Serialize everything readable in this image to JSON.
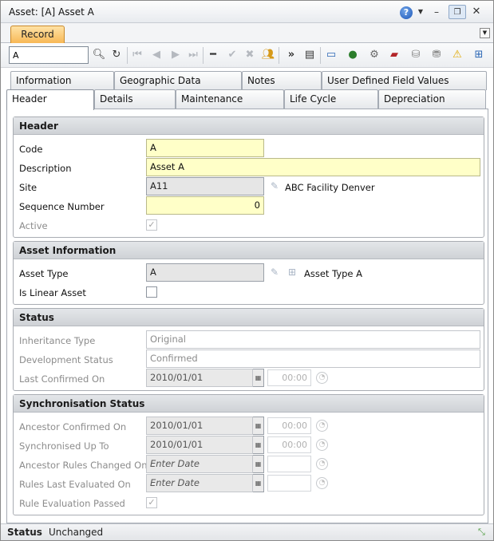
{
  "window": {
    "title": "Asset: [A] Asset A"
  },
  "ribbon": {
    "record_tab": "Record"
  },
  "toolbar": {
    "search_value": "A"
  },
  "tabs_row1": [
    "Information",
    "Geographic Data",
    "Notes",
    "User Defined Field Values"
  ],
  "tabs_row2": [
    "Header",
    "Details",
    "Maintenance",
    "Life Cycle",
    "Depreciation"
  ],
  "header_section": {
    "title": "Header",
    "code_label": "Code",
    "code_value": "A",
    "description_label": "Description",
    "description_value": "Asset A",
    "site_label": "Site",
    "site_value": "A11",
    "site_description": "ABC Facility Denver",
    "sequence_label": "Sequence Number",
    "sequence_value": "0",
    "active_label": "Active"
  },
  "asset_info_section": {
    "title": "Asset Information",
    "asset_type_label": "Asset Type",
    "asset_type_value": "A",
    "asset_type_description": "Asset Type A",
    "is_linear_label": "Is Linear Asset"
  },
  "status_section": {
    "title": "Status",
    "inheritance_label": "Inheritance Type",
    "inheritance_value": "Original",
    "development_label": "Development Status",
    "development_value": "Confirmed",
    "last_confirmed_label": "Last Confirmed On",
    "last_confirmed_date": "2010/01/01",
    "last_confirmed_time": "00:00"
  },
  "sync_section": {
    "title": "Synchronisation Status",
    "ancestor_confirmed_label": "Ancestor Confirmed On",
    "ancestor_confirmed_date": "2010/01/01",
    "ancestor_confirmed_time": "00:00",
    "sync_up_to_label": "Synchronised Up To",
    "sync_up_to_date": "2010/01/01",
    "sync_up_to_time": "00:00",
    "ancestor_rules_label": "Ancestor Rules Changed On",
    "ancestor_rules_placeholder": "Enter Date",
    "rules_evaluated_label": "Rules Last Evaluated On",
    "rules_evaluated_placeholder": "Enter Date",
    "rule_passed_label": "Rule Evaluation Passed"
  },
  "statusbar": {
    "label": "Status",
    "value": "Unchanged"
  },
  "icons": {
    "help": "help-icon",
    "minimize": "minimize-icon",
    "restore": "restore-icon",
    "close": "close-icon",
    "search": "search-icon",
    "refresh": "refresh-icon",
    "calendar": "calendar-icon",
    "clock": "clock-icon",
    "lookup": "lookup-icon",
    "tree": "tree-icon"
  },
  "colors": {
    "record_tab": "#f7b652",
    "required_field": "#ffffc8",
    "readonly_field": "#e6e6e6"
  }
}
